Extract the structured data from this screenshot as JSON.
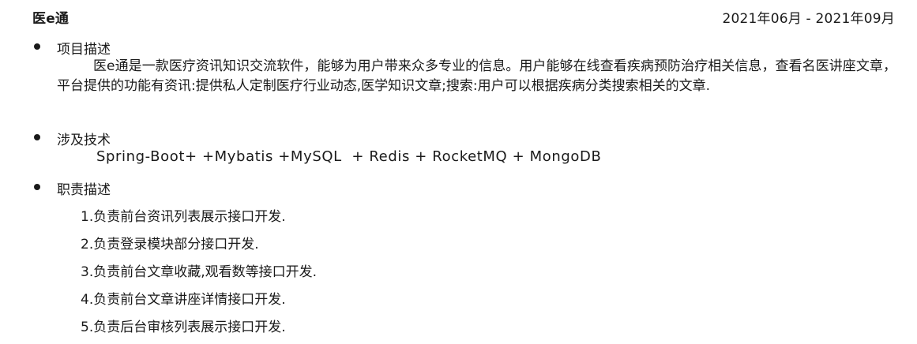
{
  "project": {
    "title": "医e通",
    "date_range": "2021年06月  - 2021年09月"
  },
  "sections": {
    "description": {
      "label": "项目描述",
      "text": "医e通是一款医疗资讯知识交流软件，能够为用户带来众多专业的信息。用户能够在线查看疾病预防治疗相关信息，查看名医讲座文章，平台提供的功能有资讯:提供私人定制医疗行业动态,医学知识文章;搜索:用户可以根据疾病分类搜索相关的文章."
    },
    "tech": {
      "label": "涉及技术",
      "text": "Spring-Boot+ +Mybatis +MySQL  + Redis + RocketMQ + MongoDB"
    },
    "duties": {
      "label": "职责描述",
      "items": [
        "1.负责前台资讯列表展示接口开发.",
        "2.负责登录模块部分接口开发.",
        "3.负责前台文章收藏,观看数等接口开发.",
        "4.负责前台文章讲座详情接口开发.",
        "5.负责后台审核列表展示接口开发."
      ]
    }
  }
}
